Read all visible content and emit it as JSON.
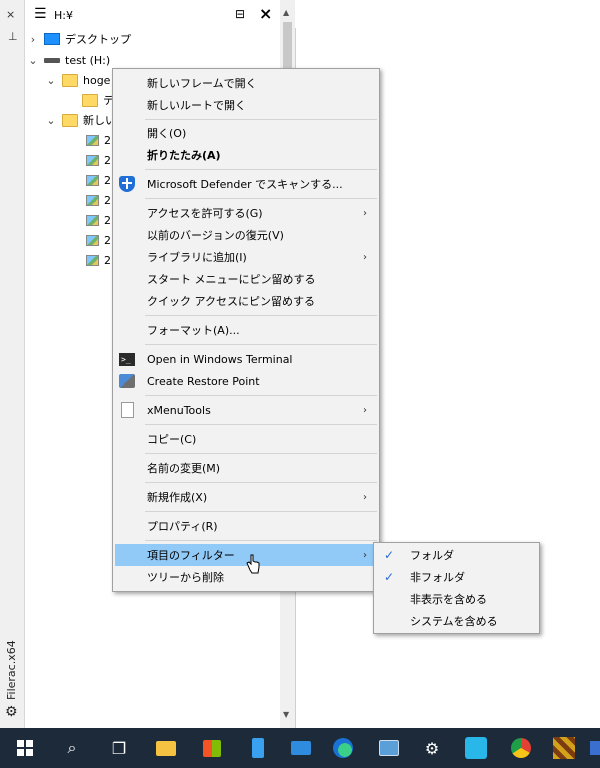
{
  "sidebar": {
    "label": "Filerac.x64",
    "icons": [
      "close-icon",
      "pin-icon",
      "gear-icon"
    ]
  },
  "pane": {
    "path": "H:¥",
    "tree": [
      {
        "label": "デスクトップ",
        "icon": "desktop-icon",
        "state": "collapsed"
      },
      {
        "label": "test (H:)",
        "icon": "drive-icon",
        "state": "expanded",
        "selected": true
      },
      {
        "label": "hoge",
        "icon": "folder-icon",
        "state": "expanded"
      },
      {
        "label": "テ",
        "icon": "folder-icon",
        "state": "leaf"
      },
      {
        "label": "新しい",
        "icon": "folder-icon",
        "state": "expanded"
      },
      {
        "label": "2",
        "icon": "image-icon",
        "state": "leaf"
      },
      {
        "label": "2",
        "icon": "image-icon",
        "state": "leaf"
      },
      {
        "label": "2",
        "icon": "image-icon",
        "state": "leaf"
      },
      {
        "label": "2",
        "icon": "image-icon",
        "state": "leaf"
      },
      {
        "label": "2",
        "icon": "image-icon",
        "state": "leaf"
      },
      {
        "label": "2",
        "icon": "image-icon",
        "state": "leaf"
      },
      {
        "label": "2",
        "icon": "image-icon",
        "state": "leaf"
      }
    ]
  },
  "menu": {
    "items": [
      {
        "label": "新しいフレームで開く"
      },
      {
        "label": "新しいルートで開く"
      },
      {
        "label": "開く(O)"
      },
      {
        "label": "折りたたみ(A)",
        "bold": true
      },
      {
        "label": "Microsoft Defender でスキャンする...",
        "icon": "defender-shield-icon"
      },
      {
        "label": "アクセスを許可する(G)",
        "submenu": true
      },
      {
        "label": "以前のバージョンの復元(V)"
      },
      {
        "label": "ライブラリに追加(I)",
        "submenu": true
      },
      {
        "label": "スタート メニューにピン留めする"
      },
      {
        "label": "クイック アクセスにピン留めする"
      },
      {
        "label": "フォーマット(A)..."
      },
      {
        "label": "Open in Windows Terminal",
        "icon": "terminal-icon"
      },
      {
        "label": "Create Restore Point",
        "icon": "restore-point-icon"
      },
      {
        "label": "xMenuTools",
        "icon": "document-icon",
        "submenu": true
      },
      {
        "label": "コピー(C)"
      },
      {
        "label": "名前の変更(M)"
      },
      {
        "label": "新規作成(X)",
        "submenu": true
      },
      {
        "label": "プロパティ(R)"
      },
      {
        "label": "項目のフィルター",
        "submenu": true,
        "highlighted": true
      },
      {
        "label": "ツリーから削除"
      }
    ],
    "submenu_arrow": "›"
  },
  "filter_submenu": {
    "items": [
      {
        "label": "フォルダ",
        "checked": true
      },
      {
        "label": "非フォルダ",
        "checked": true
      },
      {
        "label": "非表示を含める",
        "checked": false
      },
      {
        "label": "システムを含める",
        "checked": false
      }
    ],
    "check_glyph": "✓"
  },
  "taskbar": {
    "items": [
      "start-icon",
      "search-icon",
      "task-view-icon",
      "file-explorer-icon",
      "store-icon",
      "phone-icon",
      "mail-icon",
      "edge-icon",
      "news-icon",
      "settings-icon",
      "app-icon",
      "chrome-icon",
      "app-icon",
      "app-icon"
    ]
  },
  "colors": {
    "menu_highlight": "#91c9f7",
    "selection": "#cce8ff",
    "taskbar": "#1c2a3a",
    "check": "#2a6bd8"
  }
}
